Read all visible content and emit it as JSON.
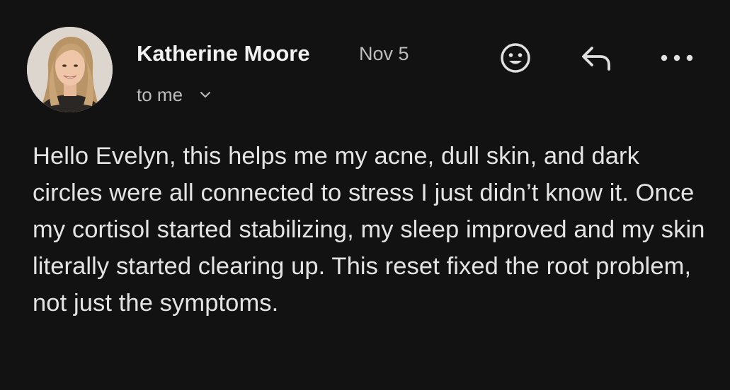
{
  "email": {
    "sender_name": "Katherine Moore",
    "date": "Nov 5",
    "recipient": "to me",
    "body": "Hello Evelyn, this helps me my acne, dull skin, and dark circles were all connected to stress I just didn’t know it. Once my cortisol started stabilizing, my sleep improved and my skin literally started clearing up. This reset fixed the root problem, not just the symptoms."
  },
  "actions": {
    "emoji_icon": "smiley-face-icon",
    "reply_icon": "reply-arrow-icon",
    "more_icon": "more-horizontal-icon",
    "chevron_icon": "chevron-down-icon"
  },
  "colors": {
    "background": "#121212",
    "primary_text": "#e4e4e4",
    "secondary_text": "#bdbdbd",
    "icon": "#e0e0e0"
  }
}
